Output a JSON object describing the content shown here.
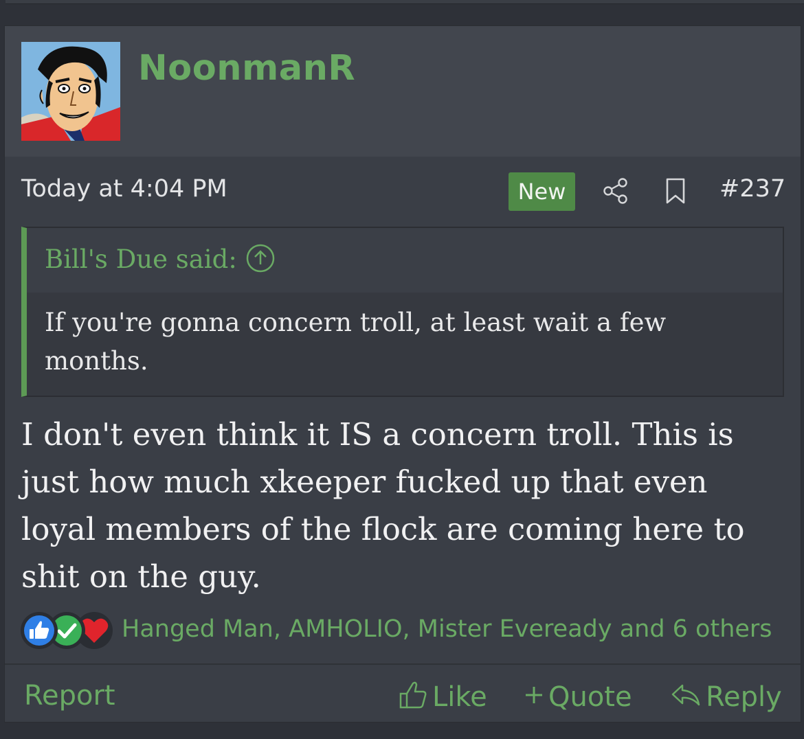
{
  "post": {
    "username": "NoonmanR",
    "timestamp": "Today at 4:04 PM",
    "badge": "New",
    "post_number": "#237",
    "quote": {
      "author": "Bill's Due said:",
      "text": "If you're gonna concern troll, at least wait a few months."
    },
    "message": "I don't even think it IS a concern troll. This is just how much xkeeper fucked up that even loyal members of the flock are coming here to shit on the guy.",
    "reactions": {
      "icons": [
        "thumbs-up-icon",
        "checkmark-icon",
        "heart-icon"
      ],
      "text": "Hanged Man, AMHOLIO, Mister Eveready and 6 others"
    },
    "actions": {
      "report": "Report",
      "like": "Like",
      "quote": "Quote",
      "reply": "Reply"
    }
  },
  "colors": {
    "accent": "#6aaa64",
    "badge_bg": "#4f8a47",
    "panel": "#3a3e46",
    "header": "#42464e"
  }
}
